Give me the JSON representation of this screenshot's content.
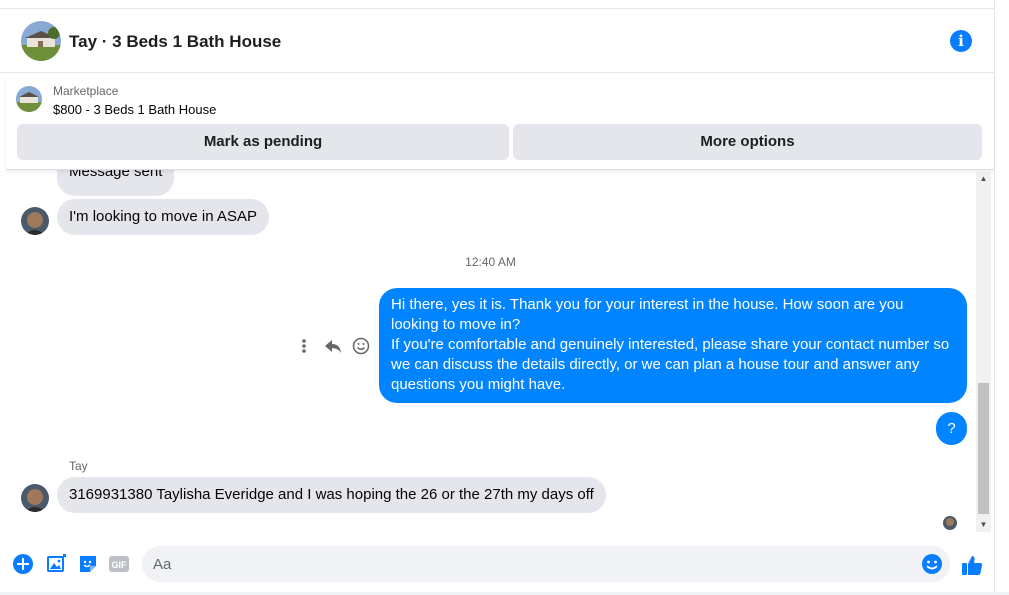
{
  "header": {
    "title": "Tay · 3 Beds 1 Bath House",
    "info_icon": "info-icon"
  },
  "marketplace": {
    "label": "Marketplace",
    "listing": "$800 - 3 Beds 1 Bath House",
    "pending_button": "Mark as pending",
    "options_button": "More options"
  },
  "conversation": {
    "previous_message": "Message sent",
    "incoming_1": "I'm looking to move in ASAP",
    "timestamp": "12:40 AM",
    "outgoing_1": "Hi there, yes it is. Thank you for your interest in the house. How soon are you looking to move in?",
    "outgoing_2": "If you're comfortable and genuinely interested, please share your contact number so we can discuss the details directly, or we can plan a house tour and answer any questions you might have.",
    "outgoing_3": "?",
    "sender_name": "Tay",
    "incoming_2": "3169931380 Taylisha Everidge and I was hoping the 26 or the 27th my days off"
  },
  "message_actions": [
    "more-icon",
    "reply-icon",
    "react-icon"
  ],
  "composer": {
    "placeholder": "Aa",
    "icons": [
      "plus-icon",
      "photo-icon",
      "sticker-icon",
      "gif-icon",
      "emoji-icon",
      "like-icon"
    ],
    "gif_label": "GIF"
  },
  "colors": {
    "accent": "#0084ff",
    "icon_blue": "#0a7cff",
    "bubble_gray": "#e4e6eb",
    "secondary_text": "#65676b"
  }
}
